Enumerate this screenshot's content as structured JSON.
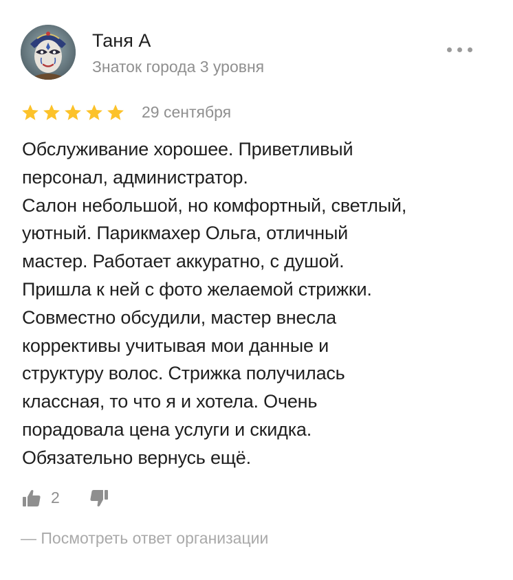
{
  "review": {
    "author": {
      "name": "Таня А",
      "level": "Знаток города 3 уровня",
      "avatar_icon": "masquerade-mask-avatar"
    },
    "rating": {
      "stars": 5,
      "max": 5,
      "color": "#fcc22a"
    },
    "date": "29 сентября",
    "text_lines": [
      "Обслуживание хорошее. Приветливый",
      "персонал, администратор.",
      "Салон небольшой, но комфортный, светлый,",
      "уютный. Парикмахер Ольга, отличный",
      "мастер. Работает аккуратно, с душой.",
      "Пришла к ней с фото желаемой стрижки.",
      "Совместно обсудили, мастер внесла",
      "коррективы учитывая мои данные и",
      "структуру волос. Стрижка получилась",
      "классная, то что я и хотела. Очень",
      "порадовала цена услуги и скидка.",
      "Обязательно вернусь ещё."
    ],
    "reactions": {
      "like_icon": "thumbs-up-icon",
      "like_count": "2",
      "dislike_icon": "thumbs-down-icon"
    },
    "org_answer_link": "— Посмотреть ответ организации",
    "menu_icon": "more-dots-icon"
  },
  "colors": {
    "text": "#1f1f1f",
    "muted": "#8f8f8f",
    "link_muted": "#a9a9a9",
    "star": "#fcc22a"
  }
}
